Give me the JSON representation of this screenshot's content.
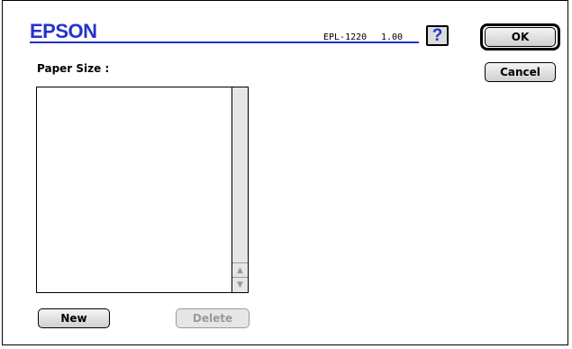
{
  "header": {
    "brand": "EPSON",
    "model": "EPL-1220",
    "version": "1.00",
    "help_label": "?"
  },
  "buttons": {
    "ok": "OK",
    "cancel": "Cancel",
    "new": "New",
    "delete": "Delete"
  },
  "paper_size": {
    "label": "Paper Size :",
    "items": []
  },
  "colors": {
    "brand_blue": "#2233cc",
    "disabled_gray": "#9a9a9a"
  }
}
